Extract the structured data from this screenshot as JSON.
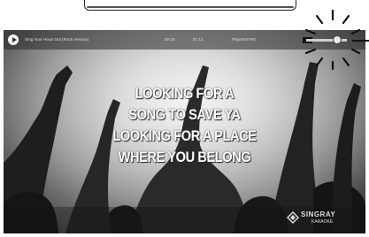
{
  "player": {
    "song_title": "Sing Your Heart Out (Rock Version)",
    "time_elapsed": "00:18",
    "time_total": "01:12",
    "source_label": "PlayAESTHE"
  },
  "lyrics": [
    "LOOKING FOR A",
    "SONG TO SAVE YA",
    "LOOKING FOR A PLACE",
    "WHERE YOU BELONG"
  ],
  "watermark": {
    "name": "SINGRAY",
    "sub": "KARAOKE"
  },
  "colors": {
    "lyric_text": "#ffffff",
    "topbar": "#282828",
    "toggle_track": "#cfcfcf"
  },
  "icons": {
    "play": "play-icon",
    "toggle": "toggle-switch",
    "tap_indicator": "tap-burst-icon"
  }
}
